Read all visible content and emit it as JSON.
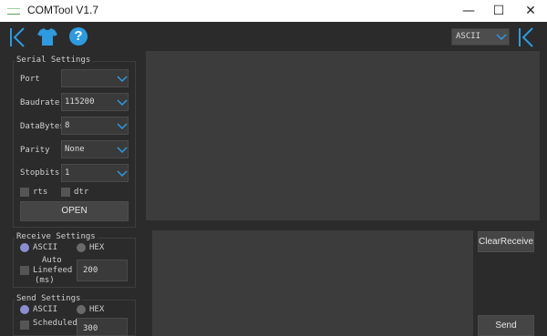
{
  "window": {
    "title": "COMTool V1.7",
    "minimize": "—",
    "maximize": "☐",
    "close": "✕"
  },
  "toolbar": {
    "icons": [
      "collapse-left-icon",
      "skin-shirt-icon",
      "help-icon",
      "collapse-right-icon"
    ],
    "help_glyph": "?",
    "encoding": "ASCII"
  },
  "serial": {
    "title": "Serial Settings",
    "port_label": "Port",
    "port_value": "",
    "baudrate_label": "Baudrate",
    "baudrate_value": "115200",
    "databytes_label": "DataBytes",
    "databytes_value": "8",
    "parity_label": "Parity",
    "parity_value": "None",
    "stopbits_label": "Stopbits",
    "stopbits_value": "1",
    "rts_label": "rts",
    "dtr_label": "dtr",
    "open_label": "OPEN"
  },
  "receive": {
    "title": "Receive Settings",
    "ascii_label": "ASCII",
    "hex_label": "HEX",
    "auto_linefeed_label_1": "Auto",
    "auto_linefeed_label_2": "Linefeed",
    "auto_linefeed_label_3": "(ms)",
    "auto_linefeed_value": "200"
  },
  "send_settings": {
    "title": "Send Settings",
    "ascii_label": "ASCII",
    "hex_label": "HEX",
    "scheduled_label": "Scheduled",
    "scheduled_value": "300"
  },
  "actions": {
    "clear_receive": "ClearReceive",
    "send": "Send"
  },
  "colors": {
    "accent": "#2e9ae0",
    "background": "#2b2b2b",
    "panel": "#3c3c3c"
  }
}
